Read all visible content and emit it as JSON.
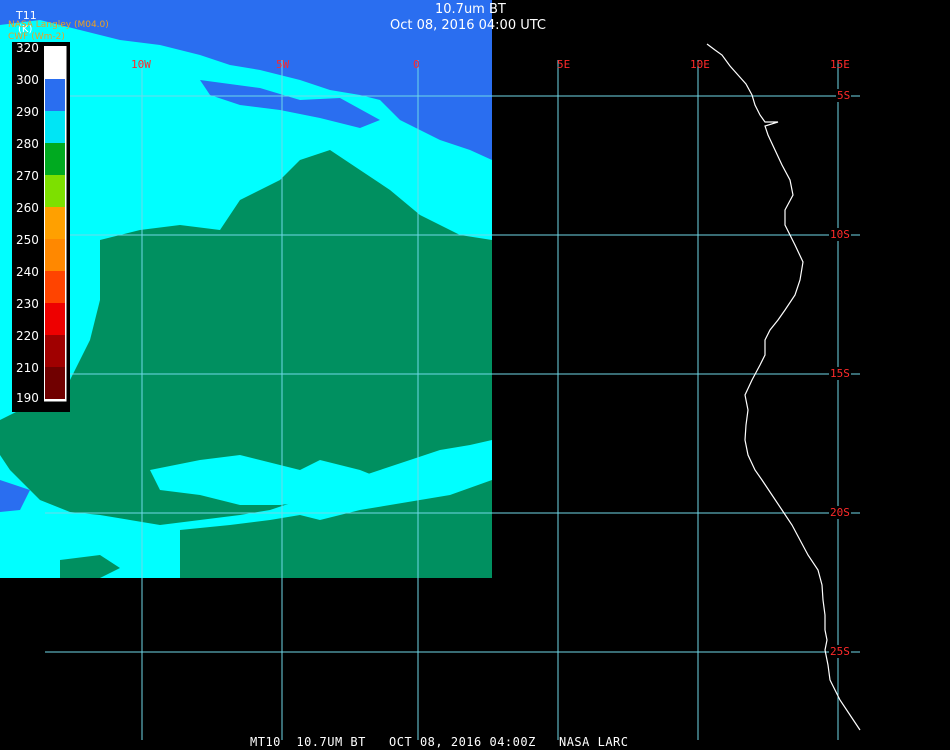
{
  "title": {
    "line1": "10.7um BT",
    "line2": "Oct 08, 2016 04:00 UTC"
  },
  "legend": {
    "title": "T11",
    "unit": "(K)",
    "provider": "NASA Langley (M04.0)",
    "secondary": "CWF (Wm-2)",
    "ticks": [
      "320",
      "300",
      "290",
      "280",
      "270",
      "260",
      "250",
      "240",
      "230",
      "220",
      "210",
      "190"
    ],
    "colors": {
      "300": "#2a6ef0",
      "290": "#00e5f5",
      "280": "#00aa20",
      "270": "#7de000",
      "260": "#ffa000",
      "250": "#ff8800",
      "240": "#ff4400",
      "230": "#ee0000",
      "220": "#a00000",
      "210": "#700000"
    }
  },
  "map": {
    "longitude_labels": [
      "10W",
      "5W",
      "0",
      "5E",
      "10E",
      "15E"
    ],
    "latitude_labels": [
      "5S",
      "10S",
      "15S",
      "20S",
      "25S"
    ],
    "colors": {
      "cold_cloud": "#2a6ef0",
      "cloud": "#00ffff",
      "warm_surface": "#009060",
      "grid": "#6fd8e8",
      "coastline": "#ffffff",
      "label": "#ff2a2a"
    }
  },
  "footer": "MT10  10.7UM BT   OCT 08, 2016 04:00Z   NASA LARC"
}
